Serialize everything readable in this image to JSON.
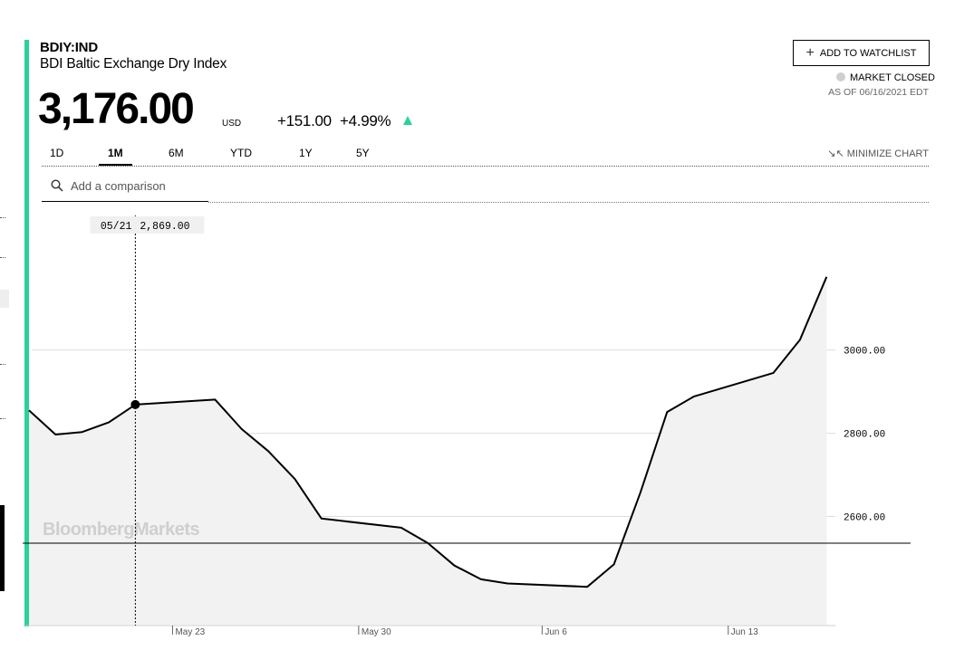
{
  "header": {
    "ticker": "BDIY:IND",
    "name": "BDI Baltic Exchange Dry Index",
    "price": "3,176.00",
    "currency": "USD",
    "change": "+151.00",
    "change_pct": "+4.99%"
  },
  "watchlist_button": {
    "label": "ADD TO WATCHLIST"
  },
  "market_status": {
    "label": "MARKET CLOSED",
    "as_of": "AS OF 06/16/2021 EDT"
  },
  "tabs": [
    {
      "label": "1D"
    },
    {
      "label": "1M",
      "active": true
    },
    {
      "label": "6M"
    },
    {
      "label": "YTD"
    },
    {
      "label": "1Y"
    },
    {
      "label": "5Y"
    }
  ],
  "minimize_label": "MINIMIZE CHART",
  "search": {
    "placeholder": "Add a comparison"
  },
  "watermark": "BloombergMarkets",
  "tooltip": {
    "date": "05/21",
    "value": "2,869.00"
  },
  "colors": {
    "accent": "#2bd19a",
    "line": "#000000",
    "area_fill": "#f2f2f2",
    "grid": "#dddddd"
  },
  "chart_data": {
    "type": "area",
    "x": [
      "05/17",
      "05/18",
      "05/19",
      "05/20",
      "05/21",
      "05/24",
      "05/25",
      "05/26",
      "05/27",
      "05/28",
      "05/31",
      "06/01",
      "06/02",
      "06/03",
      "06/04",
      "06/07",
      "06/08",
      "06/09",
      "06/10",
      "06/11",
      "06/14",
      "06/15",
      "06/16"
    ],
    "values": [
      2855,
      2797,
      2803,
      2826,
      2869,
      2881,
      2810,
      2757,
      2690,
      2595,
      2573,
      2536,
      2482,
      2449,
      2439,
      2431,
      2485,
      2658,
      2851,
      2888,
      2945,
      3025,
      3176
    ],
    "x_tick_labels": [
      {
        "label": "May 23",
        "x": 5.4
      },
      {
        "label": "May 30",
        "x": 12.4
      },
      {
        "label": "Jun 6",
        "x": 19.3
      },
      {
        "label": "Jun 13",
        "x": 26.3
      }
    ],
    "y_ticks": [
      "3000.00",
      "2800.00",
      "2600.00"
    ],
    "y_tick_values": [
      3000,
      2800,
      2600
    ],
    "ylim": [
      2340,
      3330
    ],
    "xlim": [
      0,
      30.5
    ],
    "x_positions": [
      0,
      1,
      2,
      3,
      4,
      7,
      8,
      9,
      10,
      11,
      14,
      15,
      16,
      17,
      18,
      21,
      22,
      23,
      24,
      25,
      28,
      29,
      30
    ],
    "highlight_index": 4,
    "grid": true,
    "legend": "none"
  }
}
